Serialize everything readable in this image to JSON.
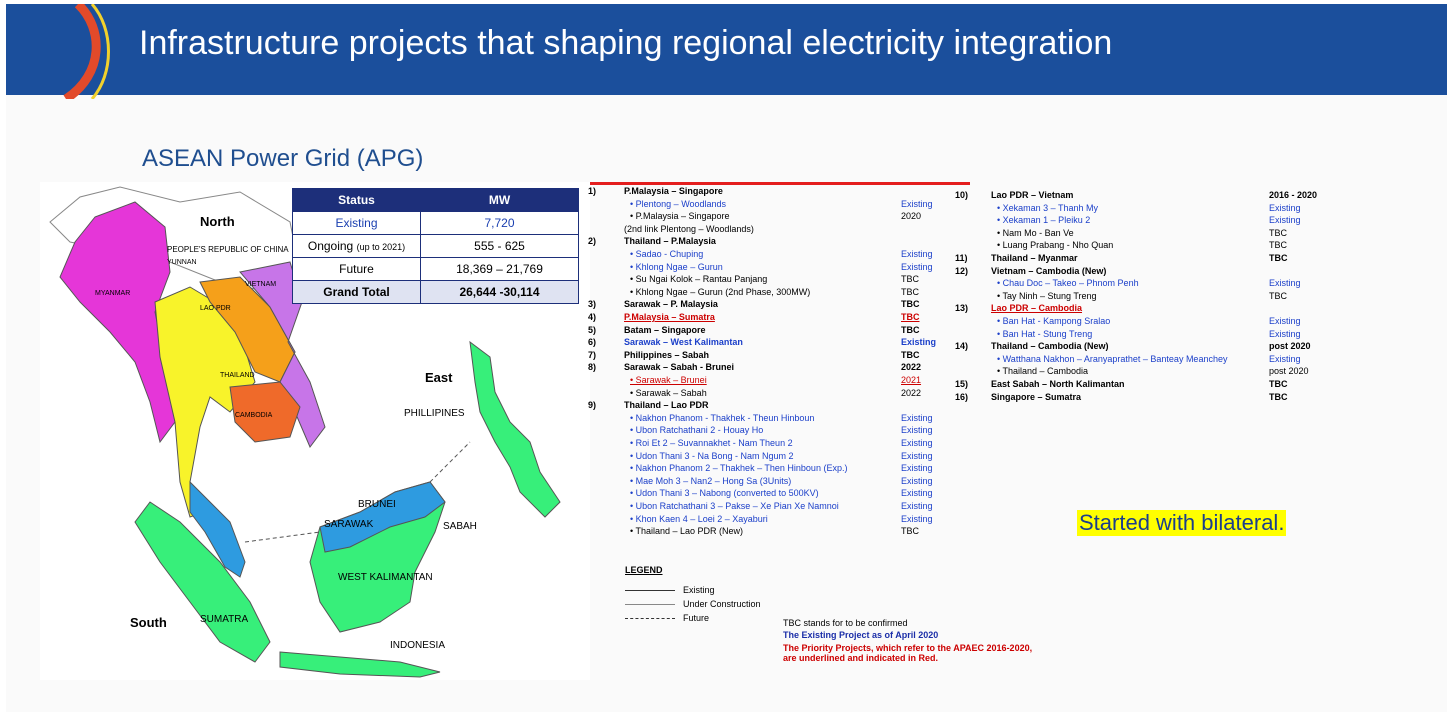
{
  "header": {
    "title": "Infrastructure projects that shaping regional electricity integration"
  },
  "subtitle": "ASEAN Power Grid (APG)",
  "map": {
    "labels": {
      "north": "North",
      "east": "East",
      "south": "South",
      "china": "PEOPLE'S REPUBLIC OF CHINA",
      "yunnan": "YUNNAN",
      "myanmar": "MYANMAR",
      "lao": "LAO PDR",
      "vietnam": "VIETNAM",
      "thailand": "THAILAND",
      "cambodia": "CAMBODIA",
      "philippines": "PHILLIPINES",
      "brunei": "BRUNEI",
      "sarawak": "SARAWAK",
      "sabah": "SABAH",
      "west_kalimantan": "WEST KALIMANTAN",
      "sumatra": "SUMATRA",
      "indonesia": "INDONESIA"
    }
  },
  "status_table": {
    "headers": [
      "Status",
      "MW"
    ],
    "rows": [
      {
        "status": "Existing",
        "mw": "7,720"
      },
      {
        "status": "Ongoing",
        "status_note": "(up to 2021)",
        "mw": "555 - 625"
      },
      {
        "status": "Future",
        "mw": "18,369 – 21,769"
      },
      {
        "status": "Grand Total",
        "mw": "26,644 -30,114"
      }
    ]
  },
  "projects_left": {
    "items": [
      {
        "n": "1)",
        "t": "P.Malaysia – Singapore",
        "s": ""
      },
      {
        "n": "",
        "t": "•   Plentong – Woodlands",
        "s": "Existing",
        "c": "blu"
      },
      {
        "n": "",
        "t": "•   P.Malaysia – Singapore",
        "s": "2020"
      },
      {
        "n": "",
        "t": "(2nd link Plentong – Woodlands)",
        "s": ""
      },
      {
        "n": "2)",
        "t": "Thailand – P.Malaysia",
        "s": ""
      },
      {
        "n": "",
        "t": "•   Sadao - Chuping",
        "s": "Existing",
        "c": "blu"
      },
      {
        "n": "",
        "t": "•   Khlong Ngae – Gurun",
        "s": "Existing",
        "c": "blu"
      },
      {
        "n": "",
        "t": "•   Su Ngai Kolok – Rantau Panjang",
        "s": "TBC"
      },
      {
        "n": "",
        "t": "•   Khlong Ngae – Gurun (2nd Phase, 300MW)",
        "s": "TBC"
      },
      {
        "n": "3)",
        "t": "Sarawak – P. Malaysia",
        "s": "TBC"
      },
      {
        "n": "4)",
        "t": "P.Malaysia – Sumatra",
        "s": "TBC",
        "c": "red"
      },
      {
        "n": "5)",
        "t": "Batam – Singapore",
        "s": "TBC"
      },
      {
        "n": "6)",
        "t": "Sarawak – West Kalimantan",
        "s": "Existing",
        "c": "blu"
      },
      {
        "n": "7)",
        "t": "Philippines – Sabah",
        "s": "TBC"
      },
      {
        "n": "8)",
        "t": "Sarawak – Sabah - Brunei",
        "s": "2022"
      },
      {
        "n": "",
        "t": "•   Sarawak – Brunei",
        "s": "2021",
        "c": "red"
      },
      {
        "n": "",
        "t": "•   Sarawak – Sabah",
        "s": "2022"
      },
      {
        "n": "9)",
        "t": "Thailand – Lao PDR",
        "s": ""
      },
      {
        "n": "",
        "t": "•   Nakhon Phanom - Thakhek - Theun Hinboun",
        "s": "Existing",
        "c": "blu"
      },
      {
        "n": "",
        "t": "•   Ubon Ratchathani 2 - Houay Ho",
        "s": "Existing",
        "c": "blu"
      },
      {
        "n": "",
        "t": "•   Roi Et 2 – Suvannakhet - Nam Theun 2",
        "s": "Existing",
        "c": "blu"
      },
      {
        "n": "",
        "t": "•   Udon Thani 3 - Na Bong - Nam Ngum 2",
        "s": "Existing",
        "c": "blu"
      },
      {
        "n": "",
        "t": "•   Nakhon Phanom 2 – Thakhek – Then Hinboun (Exp.)",
        "s": "Existing",
        "c": "blu"
      },
      {
        "n": "",
        "t": "•   Mae Moh 3 – Nan2 – Hong Sa (3Units)",
        "s": "Existing",
        "c": "blu"
      },
      {
        "n": "",
        "t": "•   Udon Thani 3 – Nabong (converted to 500KV)",
        "s": "Existing",
        "c": "blu"
      },
      {
        "n": "",
        "t": "•   Ubon Ratchathani 3 – Pakse – Xe Pian Xe Namnoi",
        "s": "Existing",
        "c": "blu"
      },
      {
        "n": "",
        "t": "•   Khon Kaen 4 – Loei 2 – Xayaburi",
        "s": "Existing",
        "c": "blu"
      },
      {
        "n": "",
        "t": "•   Thailand – Lao PDR (New)",
        "s": "TBC"
      }
    ]
  },
  "projects_right": {
    "items": [
      {
        "n": "10)",
        "t": "Lao PDR – Vietnam",
        "s": "2016 - 2020"
      },
      {
        "n": "",
        "t": "•   Xekaman 3 – Thanh My",
        "s": "Existing",
        "c": "blu"
      },
      {
        "n": "",
        "t": "•   Xekaman 1 – Pleiku 2",
        "s": "Existing",
        "c": "blu"
      },
      {
        "n": "",
        "t": "•   Nam Mo - Ban Ve",
        "s": "TBC"
      },
      {
        "n": "",
        "t": "•   Luang Prabang - Nho Quan",
        "s": "TBC"
      },
      {
        "n": "11)",
        "t": "Thailand – Myanmar",
        "s": "TBC"
      },
      {
        "n": "12)",
        "t": "Vietnam – Cambodia (New)",
        "s": ""
      },
      {
        "n": "",
        "t": "•   Chau Doc – Takeo – Phnom Penh",
        "s": "Existing",
        "c": "blu"
      },
      {
        "n": "",
        "t": "•   Tay Ninh – Stung Treng",
        "s": "TBC"
      },
      {
        "n": "13)",
        "t": "Lao PDR – Cambodia",
        "s": "",
        "c": "red"
      },
      {
        "n": "",
        "t": "•   Ban Hat - Kampong Sralao",
        "s": "Existing",
        "c": "blu"
      },
      {
        "n": "",
        "t": "•   Ban Hat - Stung Treng",
        "s": "Existing",
        "c": "blu"
      },
      {
        "n": "14)",
        "t": "Thailand – Cambodia (New)",
        "s": "post 2020"
      },
      {
        "n": "",
        "t": "•   Watthana Nakhon – Aranyaprathet – Banteay Meanchey",
        "s": "Existing",
        "c": "blu"
      },
      {
        "n": "",
        "t": "•   Thailand – Cambodia",
        "s": "post 2020"
      },
      {
        "n": "15)",
        "t": "East Sabah – North Kalimantan",
        "s": "TBC"
      },
      {
        "n": "16)",
        "t": "Singapore – Sumatra",
        "s": "TBC"
      }
    ]
  },
  "highlight": "Started with bilateral.",
  "legend": {
    "title": "LEGEND",
    "items": [
      "Existing",
      "Under Construction",
      "Future"
    ]
  },
  "notes": {
    "tbc": "TBC stands for to be confirmed",
    "existing": "The Existing Project as of April 2020",
    "priority1": "The Priority Projects, which refer to the APAEC 2016-2020,",
    "priority2": "are underlined and indicated in Red."
  },
  "colors": {
    "header_bg": "#1b4f9c",
    "table_header": "#1d2f7a",
    "accent_red": "#e41e1e",
    "highlight": "#ffff00"
  }
}
